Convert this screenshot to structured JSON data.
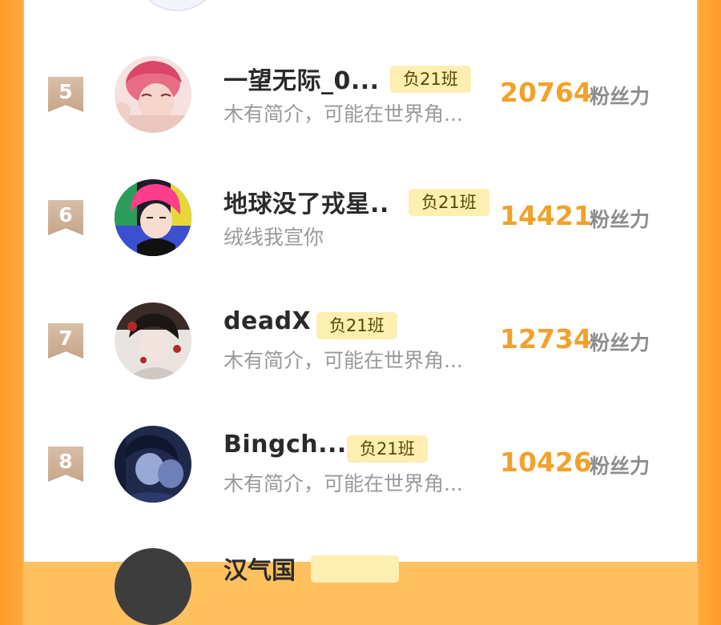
{
  "score_unit": "粉丝力",
  "badge_text": "负21班",
  "users": [
    {
      "rank": "5",
      "name": "一望无际_0...",
      "bio": "木有简介，可能在世界角...",
      "score": "20764"
    },
    {
      "rank": "6",
      "name": "地球没了戎星..",
      "bio": "绒线我宣你",
      "score": "14421"
    },
    {
      "rank": "7",
      "name": "deadX",
      "bio": "木有简介，可能在世界角...",
      "score": "12734"
    },
    {
      "rank": "8",
      "name": "Bingch...",
      "bio": "木有简介，可能在世界角...",
      "score": "10426"
    }
  ],
  "partial_next": {
    "name": "汉气国"
  },
  "colors": {
    "accent": "#f2a12a",
    "badge_bg": "#fdeeb2",
    "rank_bg": "#c6a68a",
    "border": "#ff9c2a"
  }
}
